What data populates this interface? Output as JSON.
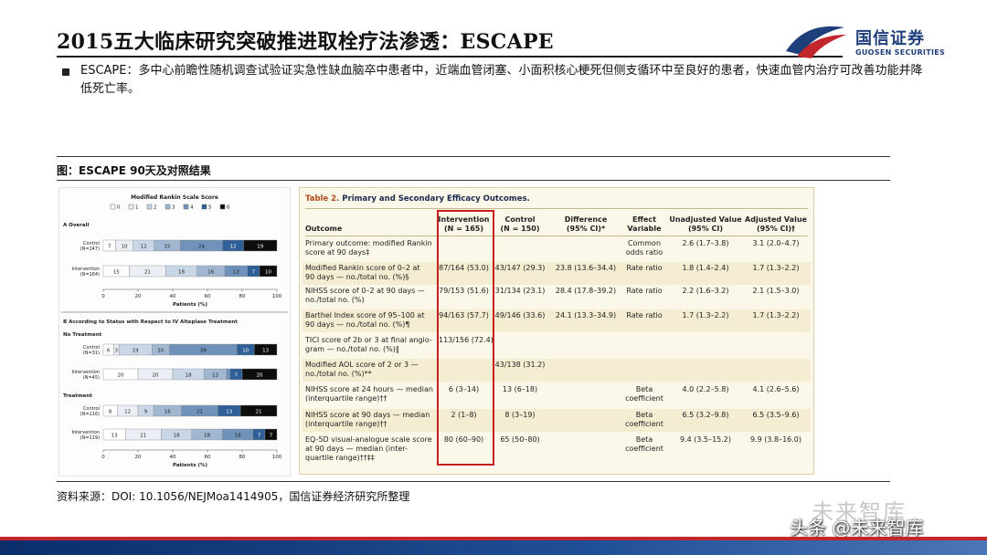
{
  "slide": {
    "title": "2015五大临床研究突破推进取栓疗法渗透：ESCAPE",
    "bullet": "ESCAPE：多中心前瞻性随机调查试验证实急性缺血脑卒中患者中，近端血管闭塞、小面积核心梗死但侧支循环中至良好的患者，快速血管内治疗可改善功能并降低死亡率。",
    "figure_label": "图：ESCAPE 90天及对照结果",
    "source": "资料来源：DOI: 10.1056/NEJMoa1414905，国信证券经济研究所整理",
    "watermark_top": "未来智库",
    "watermark_bottom": "头条 @未来智库"
  },
  "logo": {
    "cn": "国信证券",
    "en": "GUOSEN SECURITIES"
  },
  "colors": {
    "brand_red": "#c1272d",
    "brand_blue": "#1f3f7a",
    "highlight": "#c61f1f"
  },
  "chart_data": {
    "type": "bar",
    "title": "Modified Rankin Scale Score",
    "legend": [
      "0",
      "1",
      "2",
      "3",
      "4",
      "5",
      "6"
    ],
    "legend_placement": "top",
    "colors": [
      "#ffffff",
      "#ebeff5",
      "#c9d6e6",
      "#a0b6d1",
      "#6f92ba",
      "#2e5f96",
      "#0d0d0d"
    ],
    "xlabel": "Patients (%)",
    "xlim": [
      0,
      100
    ],
    "xticks": [
      0,
      20,
      40,
      60,
      80,
      100
    ],
    "panels": [
      {
        "label": "A  Overall",
        "groups": [
          {
            "header": "",
            "rows": [
              {
                "name": "Control",
                "n": "(N=147)",
                "values": [
                  7,
                  10,
                  12,
                  15,
                  24,
                  12,
                  19
                ],
                "labels": [
                  "7",
                  "10",
                  "12",
                  "15",
                  "24",
                  "12",
                  "19"
                ]
              },
              {
                "name": "Intervention",
                "n": "(N=164)",
                "values": [
                  15,
                  21,
                  18,
                  16,
                  13,
                  7,
                  10
                ],
                "labels": [
                  "15",
                  "21",
                  "18",
                  "16",
                  "13",
                  "7",
                  "10"
                ]
              }
            ]
          }
        ]
      },
      {
        "label": "B  According to Status with Respect to IV Alteplase Treatment",
        "groups": [
          {
            "header": "No Treatment",
            "rows": [
              {
                "name": "Control",
                "n": "(N=31)",
                "values": [
                  6,
                  3,
                  19,
                  10,
                  39,
                  10,
                  13
                ],
                "labels": [
                  "6",
                  "3",
                  "19",
                  "10",
                  "39",
                  "10",
                  "13"
                ]
              },
              {
                "name": "Intervention",
                "n": "(N=45)",
                "values": [
                  20,
                  20,
                  18,
                  13,
                  2,
                  7,
                  20
                ],
                "labels": [
                  "20",
                  "20",
                  "18",
                  "13",
                  "2",
                  "7",
                  "20"
                ]
              }
            ]
          },
          {
            "header": "Treatment",
            "rows": [
              {
                "name": "Control",
                "n": "(N=116)",
                "values": [
                  8,
                  12,
                  9,
                  16,
                  21,
                  13,
                  21
                ],
                "labels": [
                  "8",
                  "12",
                  "9",
                  "16",
                  "21",
                  "13",
                  "21"
                ]
              },
              {
                "name": "Intervention",
                "n": "(N=119)",
                "values": [
                  13,
                  21,
                  18,
                  18,
                  18,
                  7,
                  7
                ],
                "labels": [
                  "13",
                  "21",
                  "18",
                  "18",
                  "18",
                  "7",
                  "7"
                ]
              }
            ]
          }
        ]
      }
    ]
  },
  "table": {
    "title_prefix": "Table 2.",
    "title": "Primary and Secondary Efficacy Outcomes.",
    "headers": {
      "outcome": "Outcome",
      "intervention": [
        "Intervention",
        "(N = 165)"
      ],
      "control": [
        "Control",
        "(N = 150)"
      ],
      "difference": [
        "Difference",
        "(95% CI)*"
      ],
      "effect": [
        "Effect",
        "Variable"
      ],
      "unadjusted": [
        "Unadjusted Value",
        "(95% CI)"
      ],
      "adjusted": [
        "Adjusted Value",
        "(95% CI)†"
      ]
    },
    "rows": [
      {
        "outcome": [
          "Primary outcome: modified Rankin",
          "score at 90 days‡"
        ],
        "intervention": "",
        "control": "",
        "difference": "",
        "effect": [
          "Common",
          "odds ratio"
        ],
        "unadjusted": "2.6 (1.7–3.8)",
        "adjusted": "3.1 (2.0–4.7)"
      },
      {
        "outcome": [
          "Modified Rankin score of 0–2 at",
          "90 days — no./total no. (%)§"
        ],
        "intervention": "87/164 (53.0)",
        "control": "43/147 (29.3)",
        "difference": "23.8 (13.6–34.4)",
        "effect": [
          "Rate ratio"
        ],
        "unadjusted": "1.8 (1.4–2.4)",
        "adjusted": "1.7 (1.3–2.2)"
      },
      {
        "outcome": [
          "NIHSS score of 0–2 at 90 days —",
          "no./total no. (%)"
        ],
        "intervention": "79/153 (51.6)",
        "control": "31/134 (23.1)",
        "difference": "28.4 (17.8–39.2)",
        "effect": [
          "Rate ratio"
        ],
        "unadjusted": "2.2 (1.6–3.2)",
        "adjusted": "2.1 (1.5–3.0)"
      },
      {
        "outcome": [
          "Barthel Index score of 95–100 at",
          "90 days — no./total no. (%)¶"
        ],
        "intervention": "94/163 (57.7)",
        "control": "49/146 (33.6)",
        "difference": "24.1 (13.3–34.9)",
        "effect": [
          "Rate ratio"
        ],
        "unadjusted": "1.7 (1.3–2.2)",
        "adjusted": "1.7 (1.3–2.2)"
      },
      {
        "outcome": [
          "TICI score of 2b or 3 at final angio-",
          "gram — no./total no. (%)‖"
        ],
        "intervention": "113/156 (72.4)",
        "control": "",
        "difference": "",
        "effect": [],
        "unadjusted": "",
        "adjusted": ""
      },
      {
        "outcome": [
          "Modified AOL score of 2 or 3 —",
          "no./total no. (%)**"
        ],
        "intervention": "",
        "control": "43/138 (31.2)",
        "difference": "",
        "effect": [],
        "unadjusted": "",
        "adjusted": ""
      },
      {
        "outcome": [
          "NIHSS score at 24 hours — median",
          "(interquartile range)††"
        ],
        "intervention": "6 (3–14)",
        "control": "13 (6–18)",
        "difference": "",
        "effect": [
          "Beta",
          "coefficient"
        ],
        "unadjusted": "4.0 (2.2–5.8)",
        "adjusted": "4.1 (2.6–5.6)"
      },
      {
        "outcome": [
          "NIHSS score at 90 days — median",
          "(interquartile range)††"
        ],
        "intervention": "2 (1–8)",
        "control": "8 (3–19)",
        "difference": "",
        "effect": [
          "Beta",
          "coefficient"
        ],
        "unadjusted": "6.5 (3.2–9.8)",
        "adjusted": "6.5 (3.5–9.6)"
      },
      {
        "outcome": [
          "EQ-5D visual-analogue scale score",
          "at 90 days — median (inter-",
          "quartile range)††‡‡"
        ],
        "intervention": "80 (60–90)",
        "control": "65 (50–80)",
        "difference": "",
        "effect": [
          "Beta",
          "coefficient"
        ],
        "unadjusted": "9.4 (3.5–15.2)",
        "adjusted": "9.9 (3.8–16.0)"
      }
    ]
  }
}
